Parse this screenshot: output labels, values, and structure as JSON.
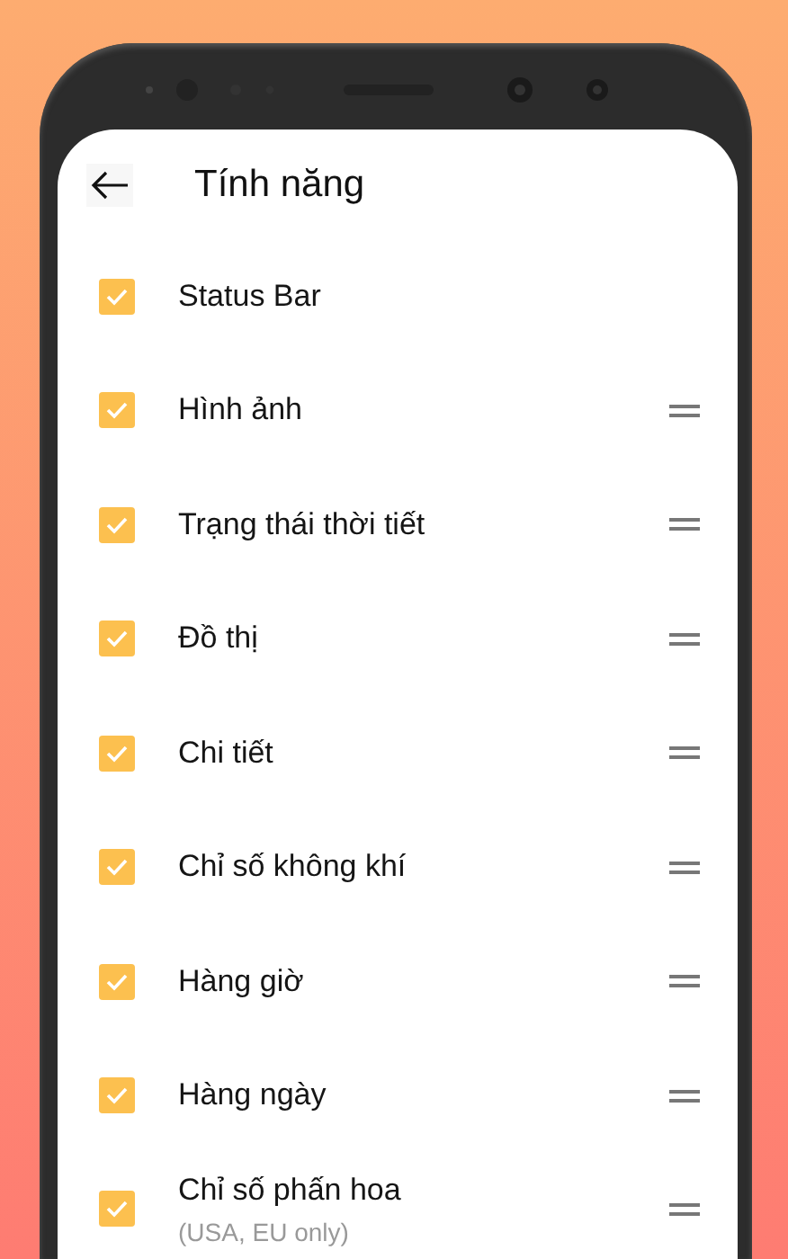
{
  "header": {
    "title": "Tính năng"
  },
  "features": [
    {
      "label": "Status Bar",
      "checked": true,
      "draggable": false
    },
    {
      "label": "Hình ảnh",
      "checked": true,
      "draggable": true
    },
    {
      "label": "Trạng thái thời tiết",
      "checked": true,
      "draggable": true
    },
    {
      "label": "Đồ thị",
      "checked": true,
      "draggable": true
    },
    {
      "label": "Chi tiết",
      "checked": true,
      "draggable": true
    },
    {
      "label": "Chỉ số không khí",
      "checked": true,
      "draggable": true
    },
    {
      "label": "Hàng giờ",
      "checked": true,
      "draggable": true
    },
    {
      "label": "Hàng ngày",
      "checked": true,
      "draggable": true
    },
    {
      "label": "Chỉ số phấn hoa",
      "note": "(USA, EU only)",
      "checked": true,
      "draggable": true
    }
  ]
}
